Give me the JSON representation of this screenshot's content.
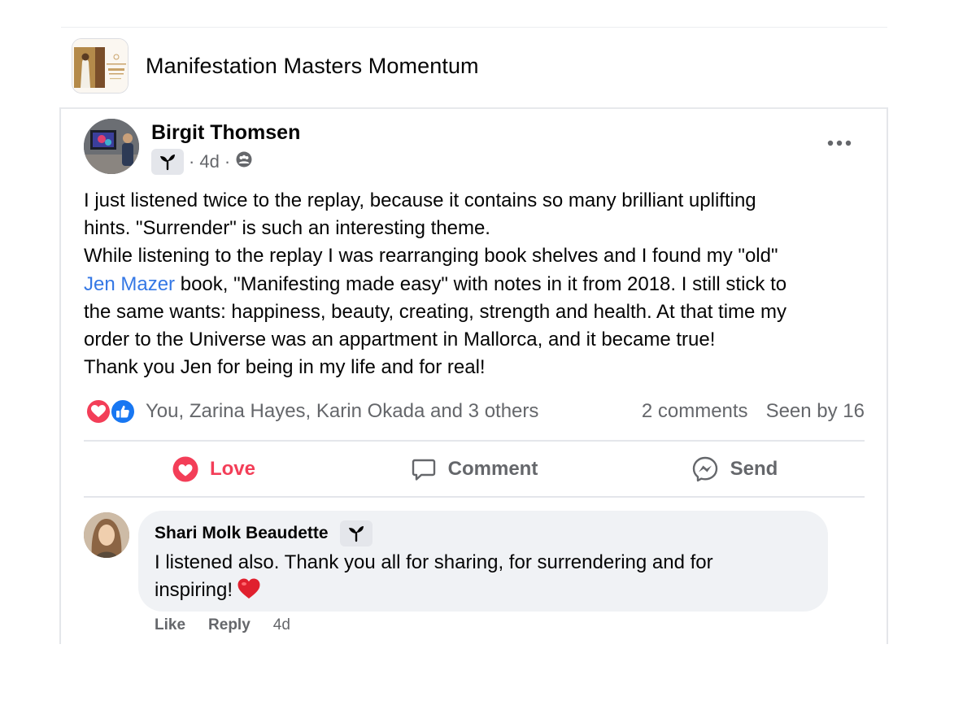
{
  "group": {
    "name": "Manifestation Masters Momentum",
    "thumbnail_icon": "group-cover-thumbnail"
  },
  "post": {
    "author": "Birgit Thomsen",
    "badge_icon": "sprout-icon",
    "time": "4d",
    "privacy_icon": "group-members-icon",
    "more_icon": "more-options-icon",
    "body": {
      "line1": "I just listened twice to the replay, because it contains so many brilliant uplifting",
      "line2": "hints. \"Surrender\" is such an interesting theme.",
      "line3": "While listening to the replay I was rearranging book shelves and I found my \"old\"",
      "line4_link": "Jen Mazer",
      "line4_rest": " book, \"Manifesting made easy\" with notes in it from 2018. I still stick to",
      "line5": "the same wants: happiness, beauty, creating, strength and health. At that time my",
      "line6": "order to the Universe was an appartment in Mallorca, and it became true!",
      "line7": "Thank you Jen for being in my life and for real!"
    },
    "reactions": {
      "icons": [
        "love-icon",
        "like-icon"
      ],
      "names": "You, Zarina Hayes, Karin Okada and 3 others",
      "comments": "2 comments",
      "seen": "Seen by 16"
    },
    "actions": {
      "love": "Love",
      "comment": "Comment",
      "send": "Send"
    }
  },
  "comment": {
    "author": "Shari Molk Beaudette",
    "badge_icon": "sprout-icon",
    "text_line1": "I listened also. Thank you all for sharing, for surrendering and for",
    "text_line2": "inspiring!",
    "emoji": "red-heart-emoji",
    "like": "Like",
    "reply": "Reply",
    "time": "4d"
  },
  "colors": {
    "love": "#f33e58",
    "like": "#1877f2",
    "link": "#3578e5",
    "secondary_text": "#65676b",
    "bubble": "#f0f2f5"
  }
}
